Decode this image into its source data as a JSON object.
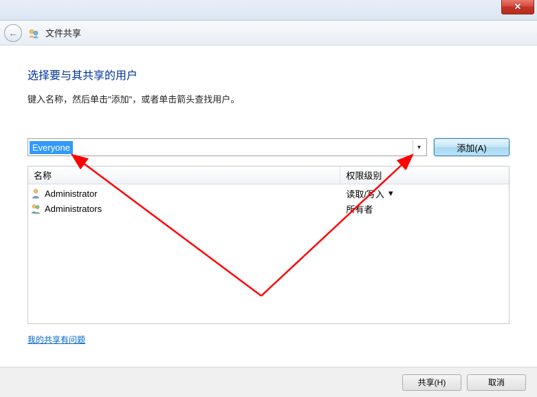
{
  "window": {
    "title": "文件共享"
  },
  "heading": "选择要与其共享的用户",
  "subtext": "键入名称，然后单击\"添加\"，或者单击箭头查找用户。",
  "combo": {
    "selected": "Everyone"
  },
  "buttons": {
    "add": "添加(A)",
    "share": "共享(H)",
    "cancel": "取消"
  },
  "table": {
    "headers": {
      "name": "名称",
      "perm": "权限级别"
    },
    "rows": [
      {
        "icon": "single",
        "name": "Administrator",
        "perm": "读取/写入",
        "hasDropdown": true
      },
      {
        "icon": "group",
        "name": "Administrators",
        "perm": "所有者",
        "hasDropdown": false
      }
    ]
  },
  "helpLink": "我的共享有问题"
}
